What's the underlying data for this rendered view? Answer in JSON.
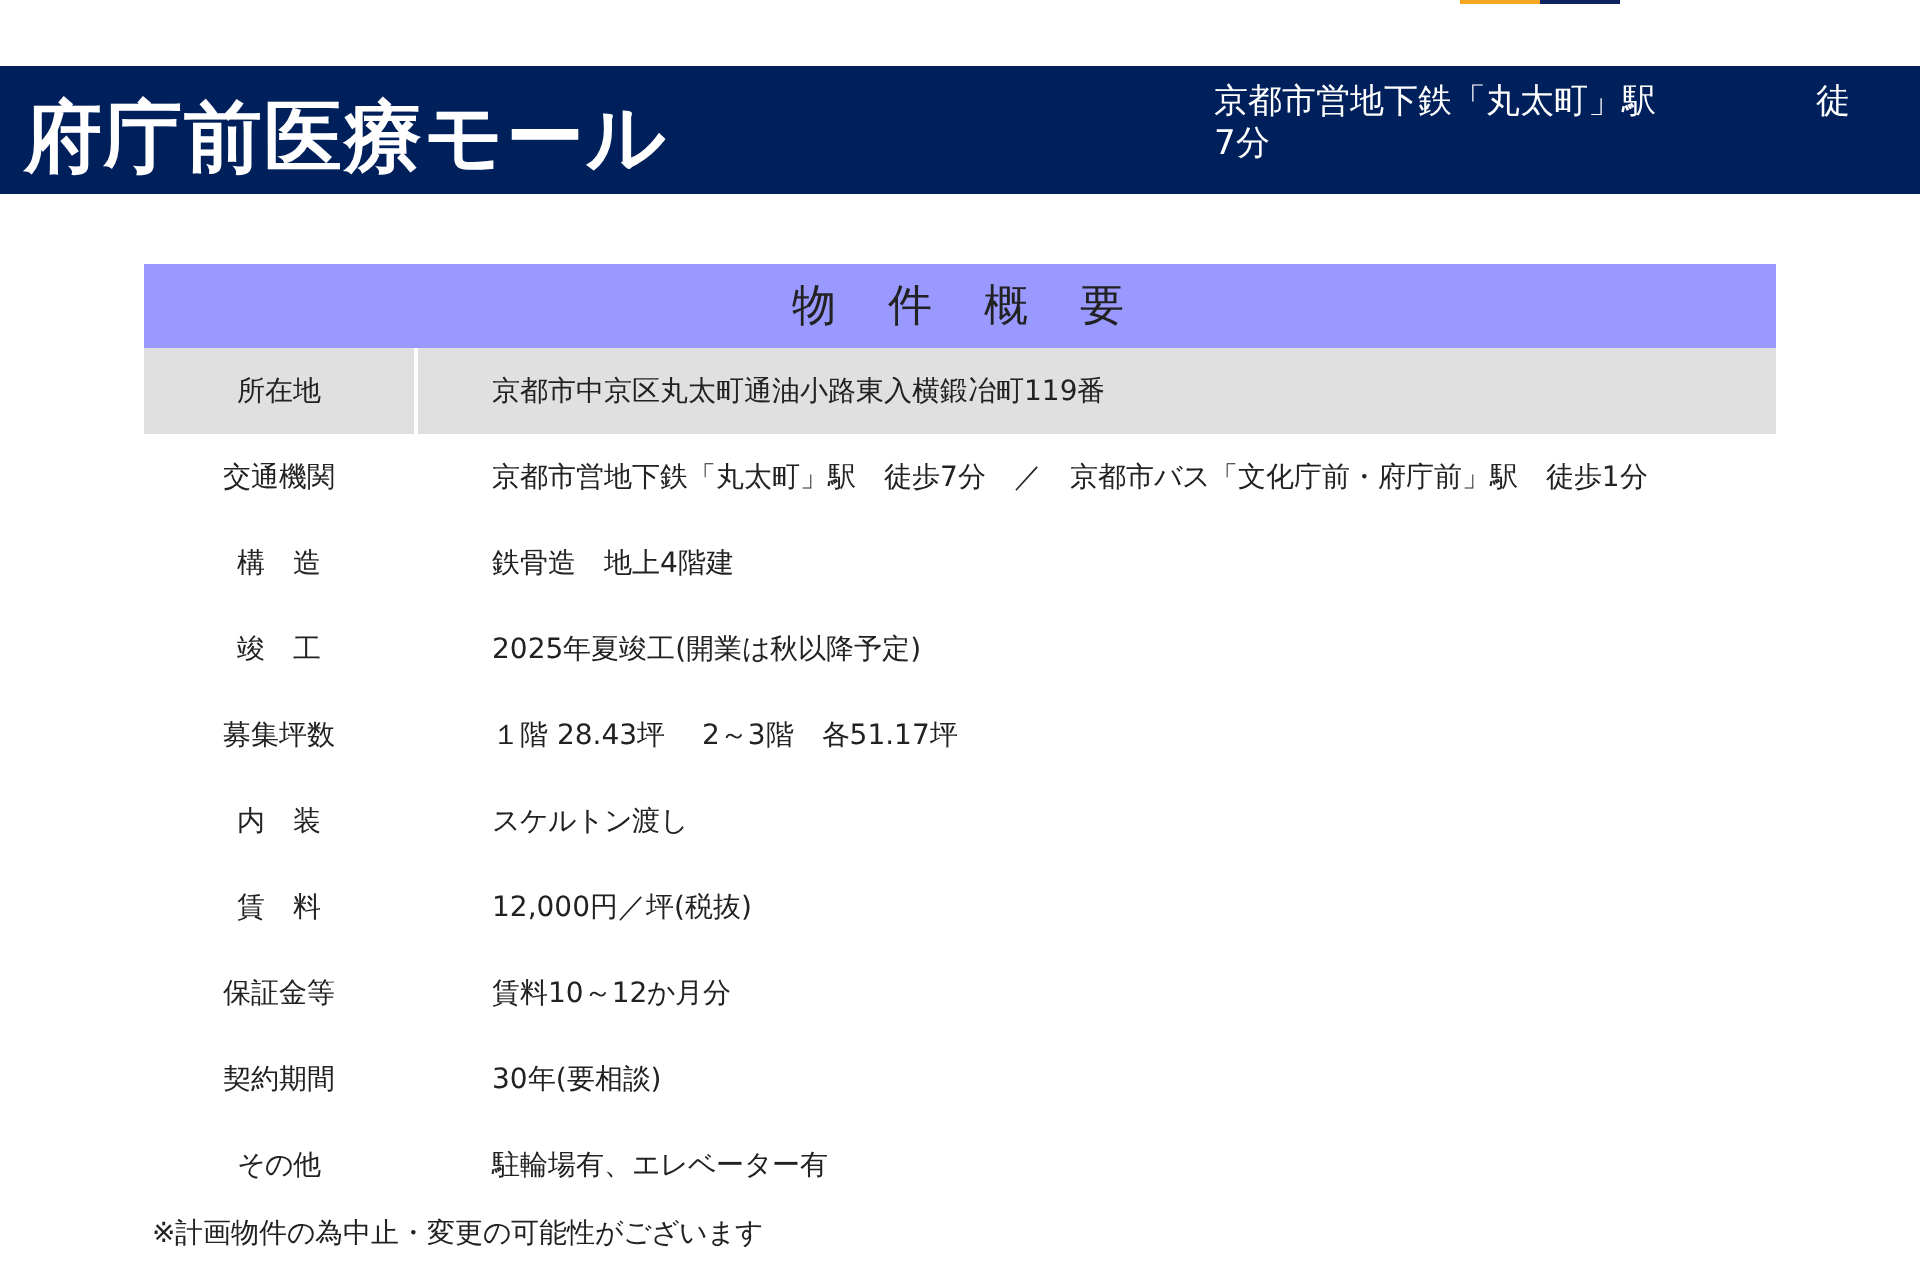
{
  "header": {
    "title": "府庁前医療モール",
    "access_line": "京都市営地下鉄「丸太町」駅",
    "access_walk": "徒",
    "access_time": "7分"
  },
  "table": {
    "title": "物　件　概　要",
    "rows": [
      {
        "label": "所在地",
        "value": "京都市中京区丸太町通油小路東入横鍛冶町119番",
        "highlighted": true
      },
      {
        "label": "交通機関",
        "value": "京都市営地下鉄「丸太町」駅　徒歩7分　／　京都市バス「文化庁前・府庁前」駅　徒歩1分",
        "highlighted": false
      },
      {
        "label": "構　造",
        "value": "鉄骨造　地上4階建",
        "highlighted": false
      },
      {
        "label": "竣　工",
        "value": "2025年夏竣工(開業は秋以降予定)",
        "highlighted": false
      },
      {
        "label": "募集坪数",
        "value": "１階 28.43坪　 2～3階　各51.17坪",
        "highlighted": false
      },
      {
        "label": "内　装",
        "value": "スケルトン渡し",
        "highlighted": false
      },
      {
        "label": "賃　料",
        "value": "12,000円／坪(税抜)",
        "highlighted": false
      },
      {
        "label": "保証金等",
        "value": "賃料10～12か月分",
        "highlighted": false
      },
      {
        "label": "契約期間",
        "value": "30年(要相談)",
        "highlighted": false
      },
      {
        "label": "その他",
        "value": "駐輪場有、エレベーター有",
        "highlighted": false
      }
    ]
  },
  "note": "※計画物件の為中止・変更の可能性がございます"
}
